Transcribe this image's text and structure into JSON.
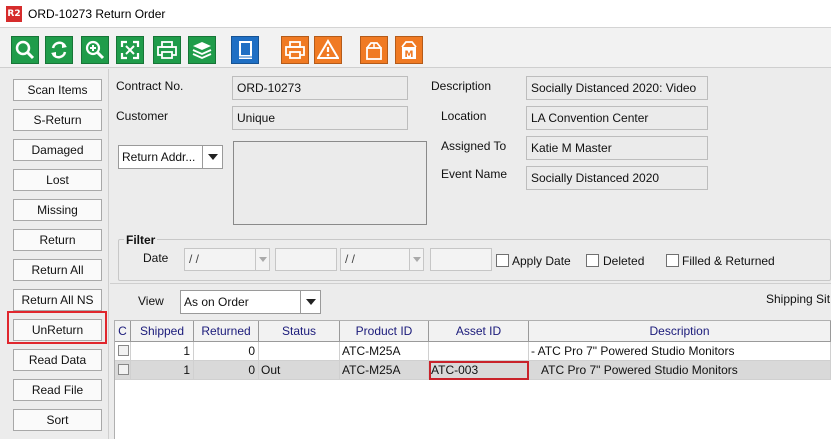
{
  "window": {
    "app_icon_text": "R2",
    "title": "ORD-10273 Return Order"
  },
  "toolbar": {
    "buttons": [
      {
        "icon": "search-icon"
      },
      {
        "icon": "refresh-icon"
      },
      {
        "icon": "zoom-in-icon"
      },
      {
        "icon": "expand-icon"
      },
      {
        "icon": "print-icon"
      },
      {
        "icon": "stack-icon"
      },
      {
        "icon": "book-icon"
      },
      {
        "icon": "print-icon"
      },
      {
        "icon": "warning-icon"
      },
      {
        "icon": "open-box-icon"
      },
      {
        "icon": "box-m-icon"
      }
    ]
  },
  "sidebar": {
    "items": [
      {
        "label": "Scan Items"
      },
      {
        "label": "S-Return"
      },
      {
        "label": "Damaged"
      },
      {
        "label": "Lost"
      },
      {
        "label": "Missing"
      },
      {
        "label": "Return"
      },
      {
        "label": "Return All"
      },
      {
        "label": "Return All NS"
      },
      {
        "label": "UnReturn"
      },
      {
        "label": "Read Data"
      },
      {
        "label": "Read File"
      },
      {
        "label": "Sort"
      }
    ]
  },
  "form": {
    "contract_label": "Contract No.",
    "contract_value": "ORD-10273",
    "customer_label": "Customer",
    "customer_value": "Unique",
    "return_addr": "Return Addr...",
    "description_label": "Description",
    "description_value": "Socially Distanced 2020: Video",
    "location_label": "Location",
    "location_value": "LA Convention Center",
    "assigned_label": "Assigned To",
    "assigned_value": "Katie M Master",
    "event_label": "Event Name",
    "event_value": "Socially Distanced 2020"
  },
  "filter": {
    "title": "Filter",
    "date_label": "Date",
    "date_from": "/ /",
    "date_to": "/ /",
    "apply_date": "Apply Date",
    "deleted": "Deleted",
    "filled_returned": "Filled & Returned"
  },
  "view": {
    "label": "View",
    "value": "As on Order",
    "shipping_label": "Shipping Sit"
  },
  "table": {
    "columns": [
      "C",
      "Shipped",
      "Returned",
      "Status",
      "Product ID",
      "Asset ID",
      "Description"
    ],
    "rows": [
      {
        "shipped": "1",
        "returned": "0",
        "status": "",
        "product_id": "ATC-M25A",
        "asset_id": "",
        "description": "- ATC Pro 7\" Powered Studio Monitors"
      },
      {
        "shipped": "1",
        "returned": "0",
        "status": "Out",
        "product_id": "ATC-M25A",
        "asset_id": "ATC-003",
        "description": "ATC Pro 7\" Powered Studio Monitors"
      }
    ]
  }
}
